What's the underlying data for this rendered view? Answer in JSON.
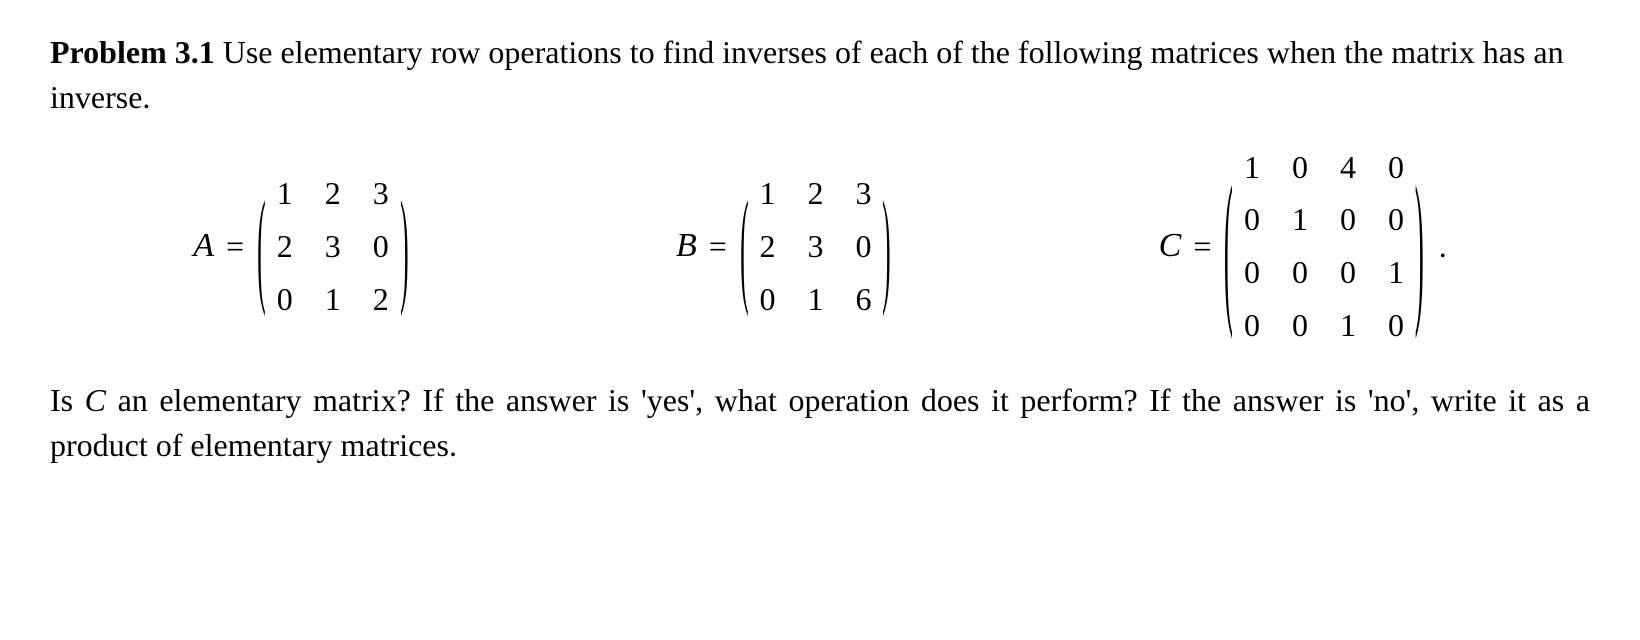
{
  "problem": {
    "label": "Problem 3.1",
    "text_part1": "  Use elementary row operations to find inverses of each of the following matrices when the matrix has an inverse."
  },
  "matrices": {
    "A": {
      "name": "A",
      "eq": "=",
      "data": [
        "1",
        "2",
        "3",
        "2",
        "3",
        "0",
        "0",
        "1",
        "2"
      ]
    },
    "B": {
      "name": "B",
      "eq": "=",
      "data": [
        "1",
        "2",
        "3",
        "2",
        "3",
        "0",
        "0",
        "1",
        "6"
      ]
    },
    "C": {
      "name": "C",
      "eq": "=",
      "data": [
        "1",
        "0",
        "4",
        "0",
        "0",
        "1",
        "0",
        "0",
        "0",
        "0",
        "0",
        "1",
        "0",
        "0",
        "1",
        "0"
      ]
    }
  },
  "question": {
    "part1": "Is ",
    "var": "C",
    "part2": " an elementary matrix?  If the answer is 'yes', what operation does it perform? If the answer is 'no', write it as a product of elementary matrices."
  },
  "symbols": {
    "lparen": "(",
    "rparen": ")",
    "period": "."
  }
}
